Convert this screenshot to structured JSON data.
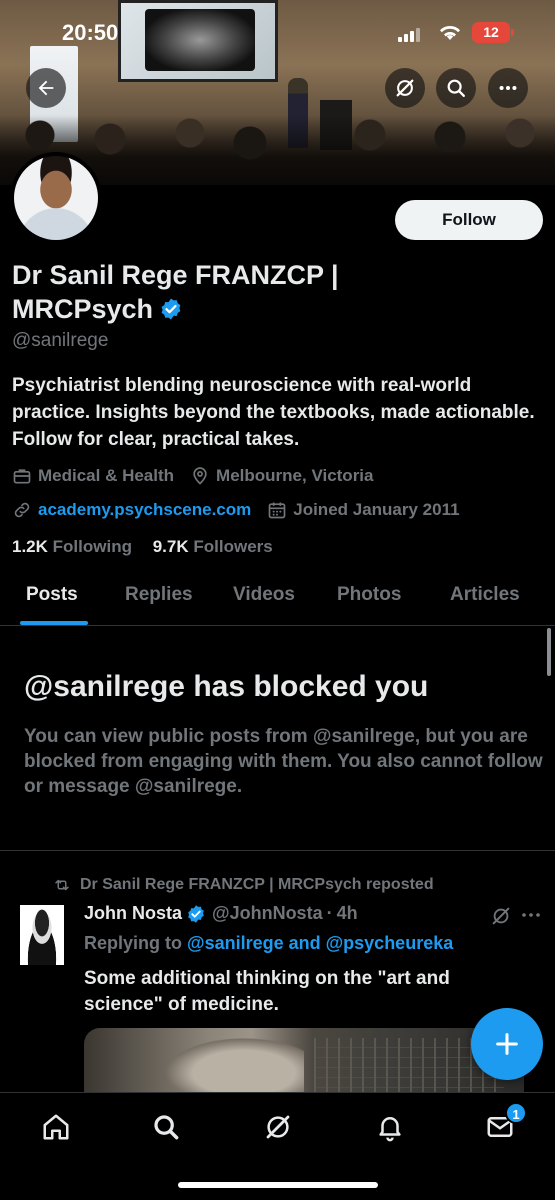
{
  "status_bar": {
    "time": "20:50",
    "battery": "12"
  },
  "profile": {
    "name": "Dr Sanil Rege FRANZCP | MRCPsych",
    "handle": "@sanilrege",
    "follow_label": "Follow",
    "bio": "Psychiatrist blending neuroscience with real-world practice. Insights beyond the textbooks, made actionable. Follow for clear, practical takes.",
    "category": "Medical & Health",
    "location": "Melbourne, Victoria",
    "website": "academy.psychscene.com",
    "joined": "Joined January 2011",
    "following_count": "1.2K",
    "following_label": "Following",
    "followers_count": "9.7K",
    "followers_label": "Followers"
  },
  "tabs": [
    {
      "label": "Posts",
      "active": true
    },
    {
      "label": "Replies",
      "active": false
    },
    {
      "label": "Videos",
      "active": false
    },
    {
      "label": "Photos",
      "active": false
    },
    {
      "label": "Articles",
      "active": false
    }
  ],
  "blocked": {
    "title": "@sanilrege has blocked you",
    "message": "You can view public posts from @sanilrege, but you are blocked from engaging with them. You also cannot follow or message @sanilrege."
  },
  "tweet": {
    "repost_label": "Dr Sanil Rege FRANZCP | MRCPsych reposted",
    "author": "John Nosta",
    "handle": "@JohnNosta",
    "separator": "·",
    "time": "4h",
    "replying_prefix": "Replying to",
    "replying_to": "@sanilrege and @psycheureka",
    "text": "Some additional thinking on the \"art and science\" of medicine."
  },
  "bottom_nav": {
    "messages_badge": "1"
  },
  "icons": [
    "back-arrow-icon",
    "grok-icon",
    "search-icon",
    "more-icon",
    "verified-icon",
    "briefcase-icon",
    "location-icon",
    "link-icon",
    "calendar-icon",
    "repost-icon",
    "compose-plus-icon",
    "home-icon",
    "bell-icon",
    "mail-icon"
  ],
  "colors": {
    "accent": "#1d9bf0",
    "background": "#000000",
    "muted": "#71767b",
    "text": "#e7e9ea"
  }
}
